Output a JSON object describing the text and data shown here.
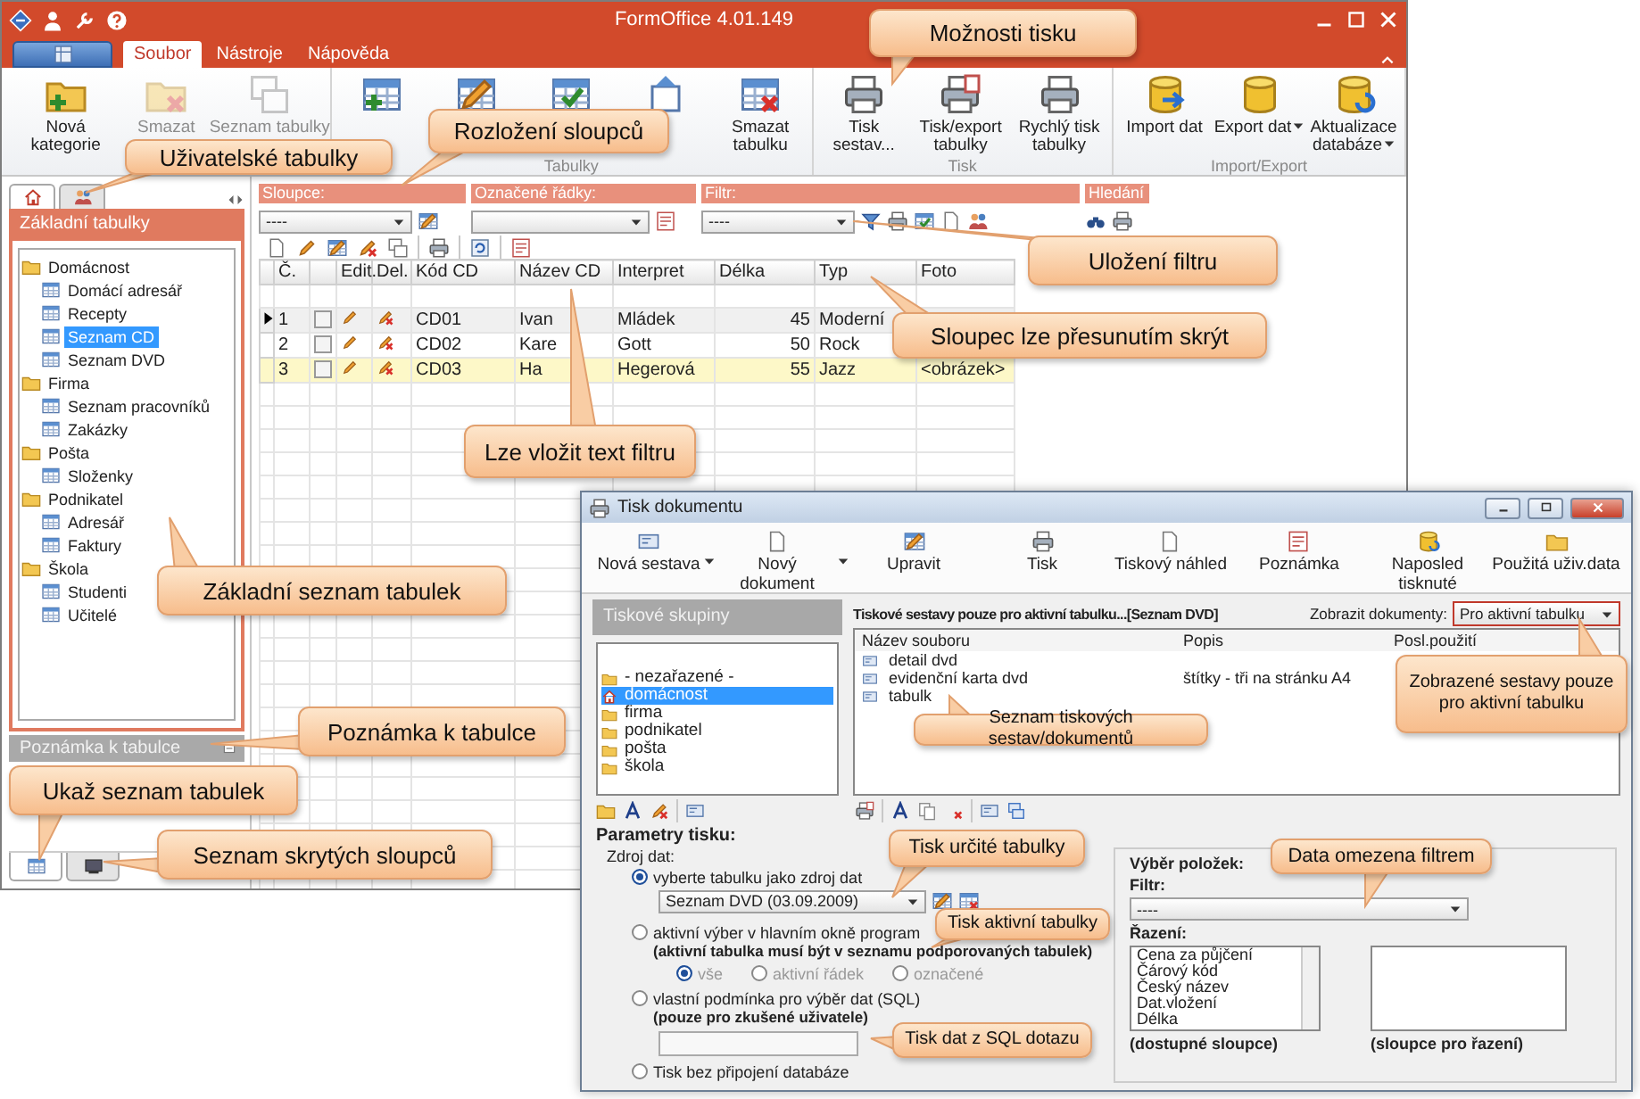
{
  "main_window": {
    "title": "FormOffice 4.01.149",
    "ribbon_tabs": [
      {
        "label": "Soubor",
        "selected": true
      },
      {
        "label": "Nástroje",
        "selected": false
      },
      {
        "label": "Nápověda",
        "selected": false
      }
    ],
    "ribbon_groups": [
      {
        "buttons": [
          {
            "label": "Nová kategorie",
            "disabled": false,
            "has_menu": false
          },
          {
            "label": "Smazat",
            "disabled": true,
            "has_menu": false
          },
          {
            "label": "Seznam tabulky",
            "disabled": true,
            "has_menu": false
          }
        ]
      },
      {
        "label": "Tabulky",
        "buttons": [
          {
            "disabled": false,
            "has_menu": false
          },
          {
            "disabled": false,
            "has_menu": false
          },
          {
            "disabled": false,
            "has_menu": false
          },
          {
            "disabled": false,
            "has_menu": false
          },
          {
            "label": "Smazat tabulku",
            "disabled": false,
            "has_menu": false
          }
        ]
      },
      {
        "label": "Tisk",
        "buttons": [
          {
            "label": "Tisk sestav...",
            "disabled": false,
            "has_menu": false
          },
          {
            "label": "Tisk/export tabulky",
            "disabled": false,
            "has_menu": false
          },
          {
            "label": "Rychlý tisk tabulky",
            "disabled": false,
            "has_menu": false
          }
        ]
      },
      {
        "label": "Import/Export",
        "buttons": [
          {
            "label": "Import dat",
            "disabled": false,
            "has_menu": false
          },
          {
            "label": "Export dat",
            "disabled": false,
            "has_menu": true
          },
          {
            "label": "Aktualizace databáze",
            "disabled": false,
            "has_menu": true
          }
        ]
      }
    ],
    "side_tabs": [
      {
        "selected": true
      },
      {
        "selected": false
      }
    ],
    "tables_header": "Základní tabulky",
    "tree": [
      {
        "label": "Domácnost",
        "selected": false,
        "children": [
          {
            "label": "Domácí adresář",
            "selected": false
          },
          {
            "label": "Recepty",
            "selected": false
          },
          {
            "label": "Seznam CD",
            "selected": true
          },
          {
            "label": "Seznam DVD",
            "selected": false
          }
        ]
      },
      {
        "label": "Firma",
        "selected": false,
        "children": [
          {
            "label": "Seznam pracovníků",
            "selected": false
          },
          {
            "label": "Zakázky",
            "selected": false
          }
        ]
      },
      {
        "label": "Pošta",
        "selected": false,
        "children": [
          {
            "label": "Složenky",
            "selected": false
          }
        ]
      },
      {
        "label": "Podnikatel",
        "selected": false,
        "children": [
          {
            "label": "Adresář",
            "selected": false
          },
          {
            "label": "Faktury",
            "selected": false
          }
        ]
      },
      {
        "label": "Škola",
        "selected": false,
        "children": [
          {
            "label": "Studenti",
            "selected": false
          },
          {
            "label": "Učitelé",
            "selected": false
          }
        ]
      }
    ],
    "note_header": "Poznámka k tabulce",
    "bottom_tabs": [
      {
        "selected": true
      },
      {
        "selected": false
      }
    ],
    "filter_bar": [
      {
        "kind": "dropdown",
        "label": "Sloupce:",
        "value": "----"
      },
      {
        "kind": "dropdown",
        "label": "Označené řádky:"
      },
      {
        "kind": "dropdown",
        "label": "Filtr:",
        "value": "----"
      },
      {
        "kind": "buttons",
        "label": "Hledání"
      }
    ],
    "table": {
      "columns": [
        "Č.",
        "Edit.",
        "Del.",
        "Kód CD",
        "Název CD",
        "Interpret",
        "Délka",
        "Typ",
        "Foto"
      ],
      "rows": [
        {
          "number": "1",
          "checked": false,
          "current": true,
          "highlighted": false,
          "code": "CD01",
          "name": "Ivan",
          "interpret": "Mládek",
          "length": "45",
          "type": "Moderní"
        },
        {
          "number": "2",
          "checked": false,
          "current": false,
          "highlighted": false,
          "code": "CD02",
          "name": "Kare",
          "interpret": "Gott",
          "length": "50",
          "type": "Rock"
        },
        {
          "number": "3",
          "checked": false,
          "current": false,
          "highlighted": true,
          "code": "CD03",
          "name": "Ha",
          "interpret": "Hegerová",
          "length": "55",
          "type": "Jazz",
          "photo": "<obrázek>"
        }
      ]
    }
  },
  "print_dialog": {
    "title": "Tisk dokumentu",
    "toolbar": [
      {
        "label": "Nová sestava",
        "has_menu": true
      },
      {
        "label": "Nový dokument",
        "has_menu": true
      },
      {
        "label": "Upravit",
        "has_menu": false
      },
      {
        "label": "Tisk",
        "has_menu": false
      },
      {
        "label": "Tiskový náhled",
        "has_menu": false
      },
      {
        "label": "Poznámka",
        "has_menu": false
      },
      {
        "label": "Naposled tisknuté",
        "has_menu": false
      },
      {
        "label": "Použitá uživ.data",
        "has_menu": false
      }
    ],
    "groups_header": "Tiskové skupiny",
    "groups": [
      {
        "label": "- nezařazené -",
        "selected": false
      },
      {
        "label": "domácnost",
        "selected": true
      },
      {
        "label": "firma",
        "selected": false
      },
      {
        "label": "podnikatel",
        "selected": false
      },
      {
        "label": "pošta",
        "selected": false
      },
      {
        "label": "škola",
        "selected": false
      }
    ],
    "reports_heading": "Tiskové sestavy pouze pro aktivní tabulku...[Seznam DVD]",
    "show_label": "Zobrazit dokumenty:",
    "show_value": "Pro aktivní tabulku",
    "report_columns": [
      "Název souboru",
      "Popis",
      "Posl.použití"
    ],
    "reports": [
      {
        "name": "detail dvd"
      },
      {
        "name": "evidenční karta dvd",
        "description": "štítky - tři na stránku A4"
      },
      {
        "name": "tabulk"
      }
    ],
    "params_title": "Parametry tisku:",
    "source_label": "Zdroj dat:",
    "source_options": [
      {
        "label": "vyberte tabulku jako zdroj dat",
        "selected": true
      },
      {
        "label": "aktivní výber v hlavním okně program",
        "selected": false
      },
      {
        "label": "vlastní podmínka pro výběr dat (SQL)",
        "selected": false
      },
      {
        "label": "Tisk bez připojení databáze",
        "selected": false
      }
    ],
    "table_choice": "Seznam DVD (03.09.2009)",
    "active_note": "(aktivní tabulka musí být v seznamu podporovaných tabulek)",
    "row_scope": [
      {
        "label": "vše",
        "selected": true,
        "disabled": true
      },
      {
        "label": "aktivní řádek",
        "selected": false,
        "disabled": true
      },
      {
        "label": "označené",
        "selected": false,
        "disabled": true
      }
    ],
    "sql_note": "(pouze pro zkušené uživatele)",
    "selection_title": "Výběr položek:",
    "filter_label": "Filtr:",
    "filter_value": "----",
    "sort_label": "Řazení:",
    "available_columns": [
      "Cena za půjčení",
      "Čárový kód",
      "Český název",
      "Dat.vložení",
      "Délka"
    ],
    "available_caption": "(dostupné sloupce)",
    "sort_caption": "(sloupce pro řazení)"
  },
  "callouts": [
    {
      "text": "Možnosti tisku"
    },
    {
      "text": "Uživatelské tabulky"
    },
    {
      "text": "Rozložení sloupců"
    },
    {
      "text": "Uložení filtru"
    },
    {
      "text": "Sloupec lze přesunutím skrýt"
    },
    {
      "text": "Lze vložit text filtru"
    },
    {
      "text": "Základní seznam tabulek"
    },
    {
      "text": "Poznámka k tabulce"
    },
    {
      "text": "Ukaž seznam tabulek"
    },
    {
      "text": "Seznam skrytých sloupců"
    },
    {
      "text": "Zobrazené sestavy pouze pro aktivní tabulku"
    },
    {
      "text": "Seznam tiskových sestav/dokumentů"
    },
    {
      "text": "Tisk určité tabulky"
    },
    {
      "text": "Data omezena filtrem"
    },
    {
      "text": "Tisk aktivní tabulky"
    },
    {
      "text": "Tisk dat z SQL dotazu"
    }
  ]
}
